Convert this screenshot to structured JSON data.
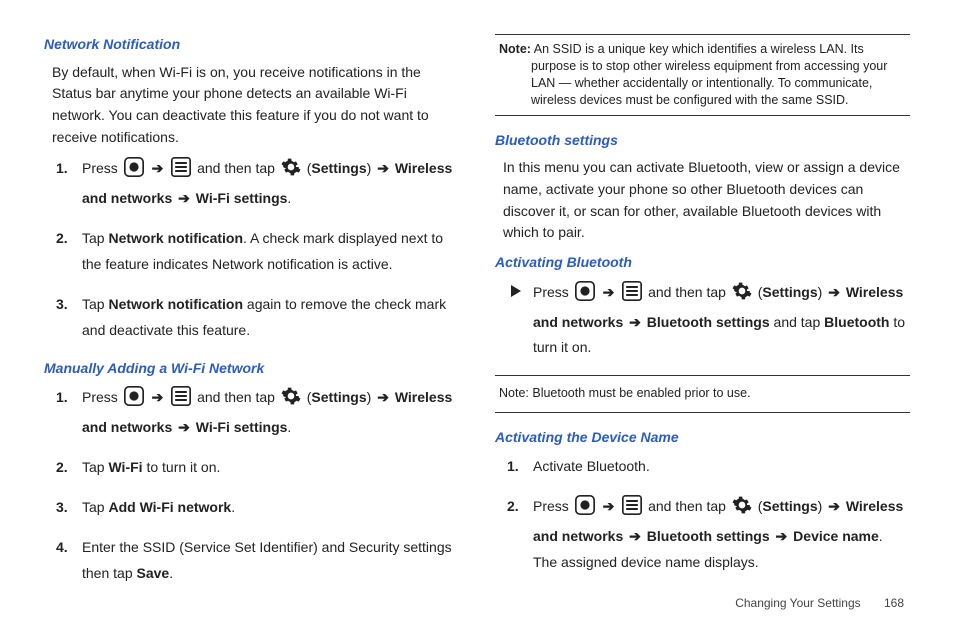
{
  "col1": {
    "h1": "Network Notification",
    "p1": "By default, when Wi-Fi is on, you receive notifications in the Status bar anytime your phone detects an available Wi-Fi network. You can deactivate this feature if you do not want to receive notifications.",
    "s1_pre": "Press ",
    "s1_tap": " and then tap ",
    "s1_settings": "Settings",
    "s1_wn": "Wireless and networks",
    "s1_wifi": "Wi-Fi settings",
    "s2_a": "Tap ",
    "s2_b": "Network notification",
    "s2_c": ". A check mark displayed next to the feature indicates Network notification is active.",
    "s3_a": "Tap ",
    "s3_b": "Network notification",
    "s3_c": " again to remove the check mark and deactivate this feature.",
    "h2": "Manually Adding a Wi-Fi Network",
    "m1_pre": "Press ",
    "m1_tap": " and then tap ",
    "m1_settings": "Settings",
    "m1_wn": "Wireless and networks",
    "m1_wifi": "Wi-Fi settings",
    "m2_a": "Tap ",
    "m2_b": "Wi-Fi",
    "m2_c": " to turn it on.",
    "m3_a": "Tap ",
    "m3_b": "Add Wi-Fi network",
    "m3_c": ".",
    "m4_a": "Enter the SSID (Service Set Identifier) and Security settings then tap ",
    "m4_b": "Save",
    "m4_c": "."
  },
  "col2": {
    "note1_label": "Note:",
    "note1": " An SSID is a unique key which identifies a wireless LAN. Its purpose is to stop other wireless equipment from accessing your LAN — whether accidentally or intentionally. To communicate, wireless devices must be configured with the same SSID.",
    "h1": "Bluetooth settings",
    "p1": "In this menu you can activate Bluetooth, view or assign a device name, activate your phone so other Bluetooth devices can discover it, or scan for other, available Bluetooth devices with which to pair.",
    "h2": "Activating Bluetooth",
    "ab_pre": "Press ",
    "ab_tap": " and then tap ",
    "ab_settings": "Settings",
    "ab_wn": "Wireless and networks",
    "ab_bt": "Bluetooth settings",
    "ab_tail1": " and tap ",
    "ab_bt2": "Bluetooth",
    "ab_tail2": " to turn it on.",
    "note2_label": "Note:",
    "note2": " Bluetooth must be enabled prior to use.",
    "h3": "Activating the Device Name",
    "d1": "Activate Bluetooth.",
    "d2_pre": "Press ",
    "d2_tap": " and then tap ",
    "d2_settings": "Settings",
    "d2_wn": "Wireless and networks",
    "d2_bt": "Bluetooth settings",
    "d2_dn": "Device name",
    "d2_tail": ". The assigned device name displays."
  },
  "footer": {
    "section": "Changing Your Settings",
    "page": "168"
  },
  "nums": {
    "n1": "1.",
    "n2": "2.",
    "n3": "3.",
    "n4": "4."
  },
  "glyph": {
    "arrow": "➔",
    "lparen": "(",
    "rparen": ")",
    "period": "."
  }
}
